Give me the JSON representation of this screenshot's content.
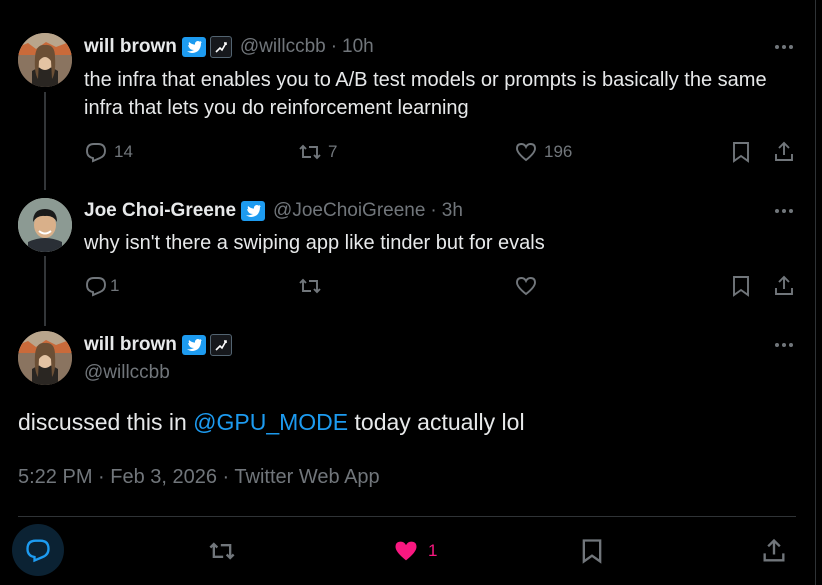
{
  "thread": [
    {
      "author": {
        "name": "will brown",
        "handle": "@willccbb",
        "verified": true,
        "affiliate": true
      },
      "time": "10h",
      "text": "the infra that enables you to A/B test models or prompts is basically the same infra that lets you do reinforcement learning",
      "actions": {
        "replies": "14",
        "reposts": "7",
        "likes": "196"
      }
    },
    {
      "author": {
        "name": "Joe Choi-Greene",
        "handle": "@JoeChoiGreene",
        "verified": true,
        "affiliate": false
      },
      "time": "3h",
      "text": "why isn't there a swiping app like tinder but for evals",
      "actions": {
        "replies": "1",
        "reposts": "",
        "likes": ""
      }
    }
  ],
  "main_tweet": {
    "author": {
      "name": "will brown",
      "handle": "@willccbb",
      "verified": true,
      "affiliate": true
    },
    "text_before": "discussed this in ",
    "mention": "@GPU_MODE",
    "text_after": " today actually lol",
    "meta": "5:22 PM · Feb 3, 2026 · Twitter Web App",
    "likes": "1",
    "liked": true
  },
  "icons": {
    "more": "more-horizontal-icon",
    "reply": "reply-icon",
    "repost": "repost-icon",
    "like": "heart-icon",
    "bookmark": "bookmark-icon",
    "share": "share-icon",
    "verified": "verified-badge-icon",
    "affiliate": "affiliate-badge-icon"
  },
  "colors": {
    "background": "#000000",
    "text": "#e7e9ea",
    "muted": "#71767b",
    "accent": "#1d9bf0",
    "like": "#f91880",
    "divider": "#2f3336"
  }
}
